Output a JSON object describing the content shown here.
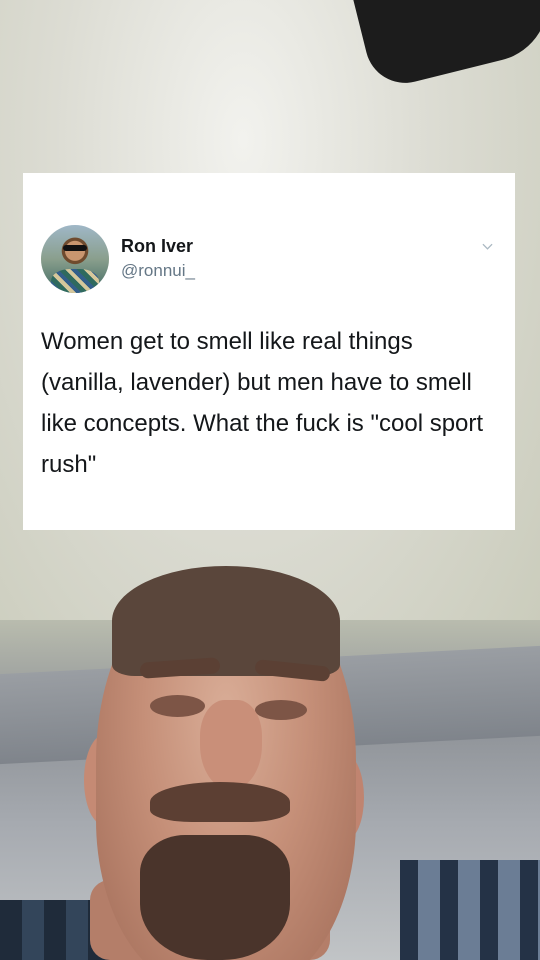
{
  "tweet": {
    "author_name": "Ron Iver",
    "author_handle": "@ronnui_",
    "text": "Women get to smell like real things (vanilla, lavender) but men have to smell like concepts. What the fuck is \"cool sport rush\"",
    "avatar_icon": "profile-photo",
    "menu_icon": "chevron-down-icon"
  },
  "colors": {
    "card_background": "#ffffff",
    "name_color": "#14171a",
    "handle_color": "#657786"
  }
}
